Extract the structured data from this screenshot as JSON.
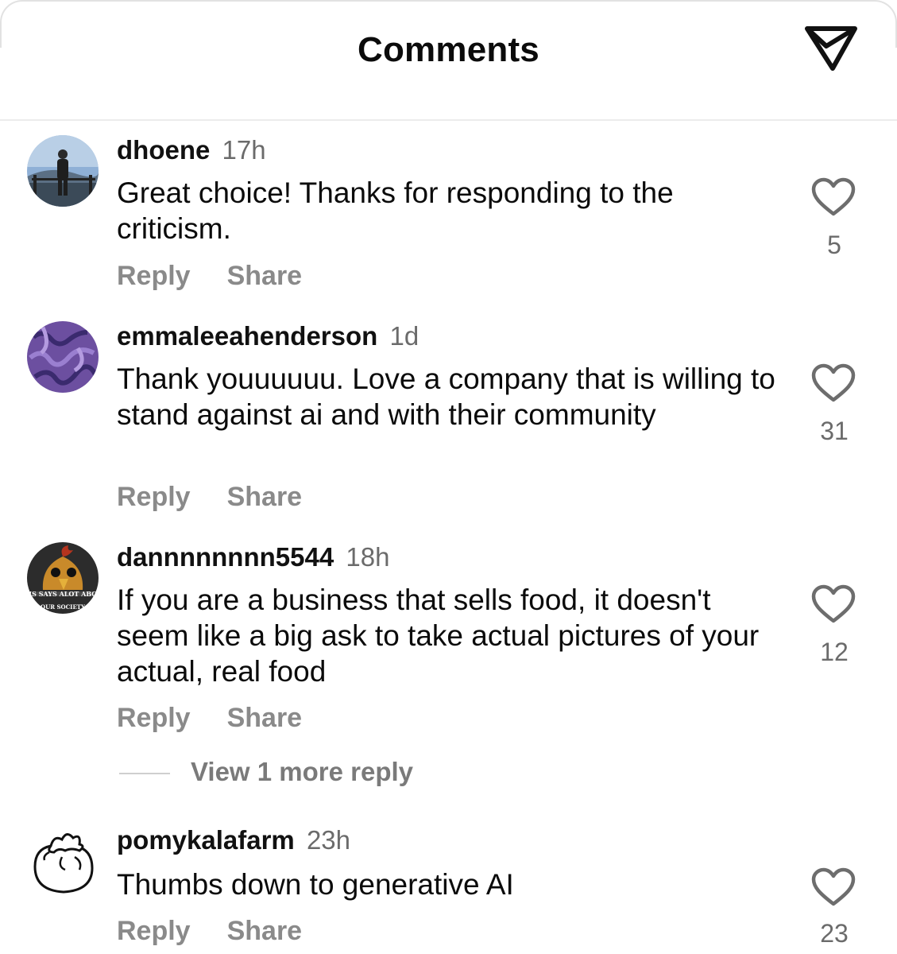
{
  "header": {
    "title": "Comments",
    "send_icon": "send-icon"
  },
  "comments": [
    {
      "username": "dhoene",
      "time": "17h",
      "text": "Great choice! Thanks for responding to the criticism.",
      "likes": "5",
      "reply_label": "Reply",
      "share_label": "Share",
      "avatar": "profile-photo"
    },
    {
      "username": "emmaleeahenderson",
      "time": "1d",
      "text": "Thank youuuuuu. Love a company that is willing to stand against ai and with their community",
      "likes": "31",
      "reply_label": "Reply",
      "share_label": "Share",
      "avatar": "purple-pattern"
    },
    {
      "username": "dannnnnnnn5544",
      "time": "18h",
      "text": "If you are a business that sells food, it doesn't seem like a big ask to take actual pictures of your actual, real food",
      "likes": "12",
      "reply_label": "Reply",
      "share_label": "Share",
      "avatar": "meme-image"
    },
    {
      "username": "pomykalafarm",
      "time": "23h",
      "text": "Thumbs down to generative AI",
      "likes": "23",
      "reply_label": "Reply",
      "share_label": "Share",
      "avatar": "tomato-logo"
    }
  ],
  "view_more_replies": "View 1 more reply",
  "colors": {
    "muted": "#8a8a8a",
    "text": "#0b0b0b",
    "divider": "#ececec"
  }
}
